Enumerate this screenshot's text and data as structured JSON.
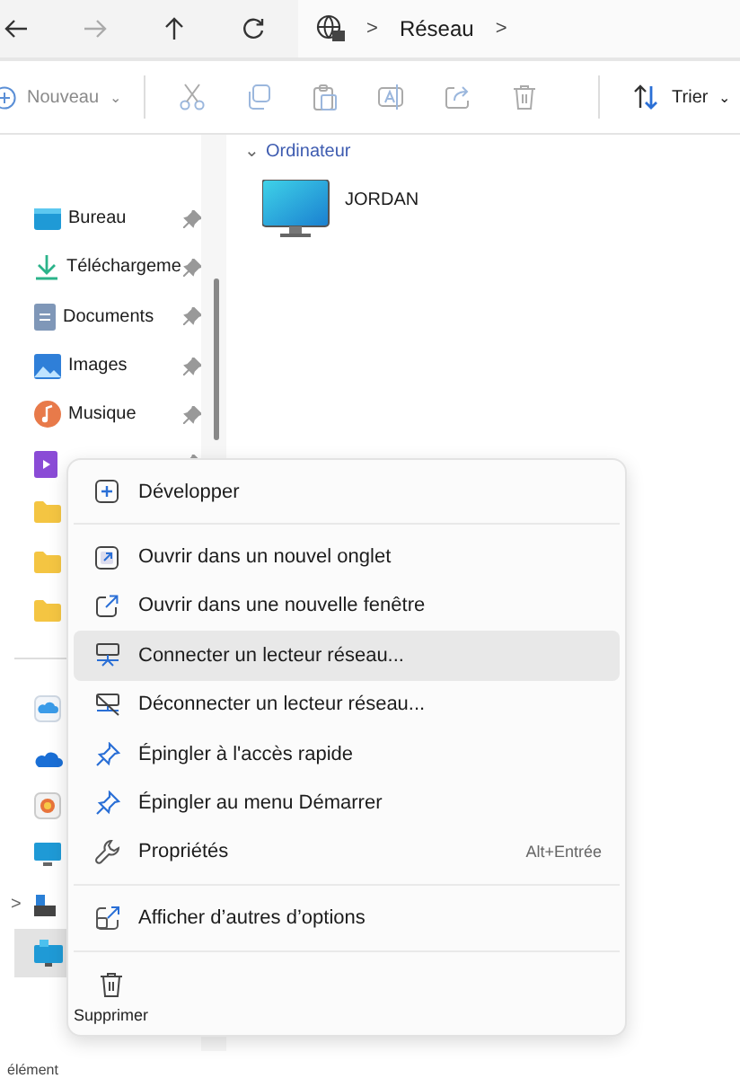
{
  "nav": {
    "back_enabled": true,
    "forward_enabled": false
  },
  "breadcrumb": {
    "separator_before": ">",
    "location": "Réseau",
    "separator_after": ">"
  },
  "toolbar": {
    "new_label": "Nouveau",
    "new_chevron": "⌄",
    "new_enabled": false,
    "sort_label": "Trier",
    "sort_chevron": "⌄"
  },
  "sidebar": {
    "items": [
      {
        "kind": "desktop",
        "label": "Bureau",
        "pinned": true,
        "selected": false
      },
      {
        "kind": "download",
        "label": "Téléchargeme",
        "pinned": true,
        "selected": false
      },
      {
        "kind": "documents",
        "label": "Documents",
        "pinned": true,
        "selected": false
      },
      {
        "kind": "images",
        "label": "Images",
        "pinned": true,
        "selected": false
      },
      {
        "kind": "music",
        "label": "Musique",
        "pinned": true,
        "selected": false
      },
      {
        "kind": "videos",
        "pinned": true,
        "selected": false
      },
      {
        "kind": "folder",
        "selected": false
      },
      {
        "kind": "folder",
        "selected": false
      },
      {
        "kind": "folder",
        "selected": false
      },
      {
        "kind": "divider"
      },
      {
        "kind": "cloud-box",
        "selected": false
      },
      {
        "kind": "cloud",
        "selected": false
      },
      {
        "kind": "photos",
        "selected": false
      },
      {
        "kind": "pc",
        "selected": false
      },
      {
        "kind": "drive",
        "expander": ">",
        "selected": false
      },
      {
        "kind": "network",
        "selected": true
      }
    ]
  },
  "content": {
    "group": {
      "chevron": "⌄",
      "title": "Ordinateur"
    },
    "items": [
      {
        "name": "JORDAN"
      }
    ]
  },
  "context_menu": {
    "items": [
      {
        "kind": "item",
        "label": "Développer",
        "selected": false
      },
      {
        "kind": "separator"
      },
      {
        "kind": "item",
        "label": "Ouvrir dans un nouvel onglet",
        "selected": false
      },
      {
        "kind": "item",
        "label": "Ouvrir dans une nouvelle fenêtre",
        "selected": false
      },
      {
        "kind": "item",
        "label": "Connecter un lecteur réseau...",
        "selected": true
      },
      {
        "kind": "item",
        "label": "Déconnecter un lecteur réseau...",
        "selected": false
      },
      {
        "kind": "item",
        "label": "Épingler à l'accès rapide",
        "selected": false
      },
      {
        "kind": "item",
        "label": "Épingler au menu Démarrer",
        "selected": false
      },
      {
        "kind": "item",
        "label": "Propriétés",
        "shortcut": "Alt+Entrée",
        "selected": false
      },
      {
        "kind": "separator"
      },
      {
        "kind": "item",
        "label": "Afficher d’autres d’options",
        "selected": false
      },
      {
        "kind": "separator"
      }
    ],
    "actions": [
      {
        "label": "Supprimer"
      }
    ]
  },
  "status_bar": {
    "text": "élément"
  }
}
